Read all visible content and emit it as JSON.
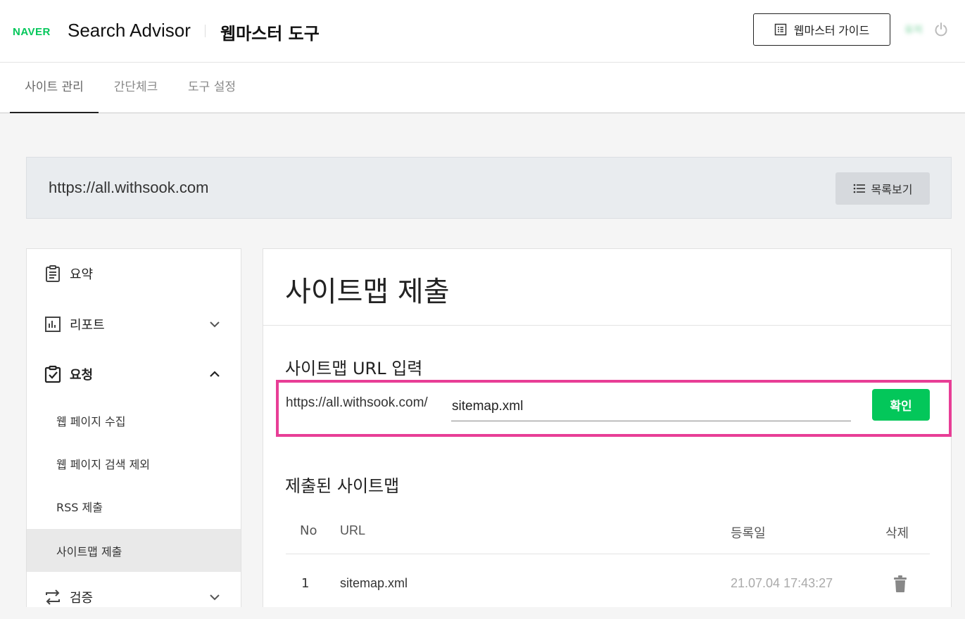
{
  "header": {
    "logo": "NAVER",
    "product": "Search Advisor",
    "title": "웹마스터 도구",
    "guide_button": "웹마스터 가이드",
    "user_name": "유저"
  },
  "tabs": [
    {
      "label": "사이트 관리",
      "active": true
    },
    {
      "label": "간단체크",
      "active": false
    },
    {
      "label": "도구 설정",
      "active": false
    }
  ],
  "site": {
    "url": "https://all.withsook.com",
    "list_button": "목록보기"
  },
  "sidebar": {
    "items": [
      {
        "label": "요약",
        "icon": "clipboard-icon"
      },
      {
        "label": "리포트",
        "icon": "bar-chart-icon",
        "expanded": false
      },
      {
        "label": "요청",
        "icon": "clipboard-check-icon",
        "expanded": true
      }
    ],
    "subitems": [
      {
        "label": "웹 페이지 수집",
        "active": false
      },
      {
        "label": "웹 페이지 검색 제외",
        "active": false
      },
      {
        "label": "RSS 제출",
        "active": false
      },
      {
        "label": "사이트맵 제출",
        "active": true
      }
    ],
    "last_item": {
      "label": "검증",
      "icon": "swap-arrows-icon",
      "expanded": false
    }
  },
  "main": {
    "title": "사이트맵 제출",
    "input_section": {
      "heading": "사이트맵 URL 입력",
      "prefix": "https://all.withsook.com/",
      "value": "sitemap.xml",
      "confirm_button": "확인"
    },
    "submitted_section": {
      "heading": "제출된 사이트맵",
      "columns": [
        "No",
        "URL",
        "등록일",
        "삭제"
      ],
      "rows": [
        {
          "no": "1",
          "url": "sitemap.xml",
          "date": "21.07.04 17:43:27"
        }
      ]
    }
  },
  "colors": {
    "brand_green": "#03c75a",
    "highlight_pink": "#e83e96"
  }
}
